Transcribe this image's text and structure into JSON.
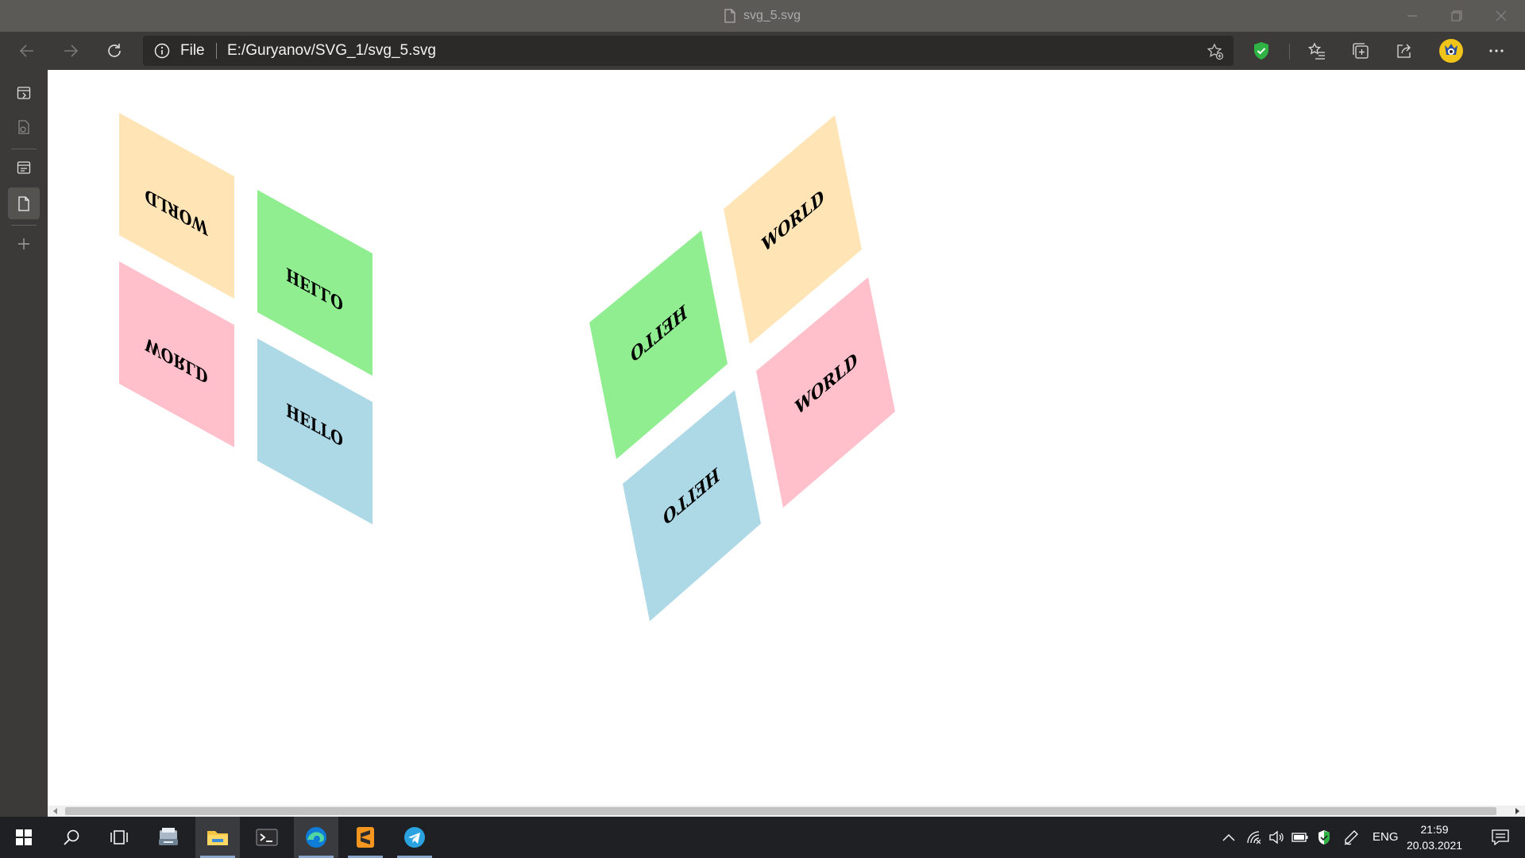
{
  "window": {
    "title": "svg_5.svg"
  },
  "address_bar": {
    "protocol_label": "File",
    "url": "E:/Guryanov/SVG_1/svg_5.svg"
  },
  "svg_content": {
    "labels": {
      "hello": "HELLO",
      "world": "WORLD"
    },
    "colors": {
      "green": "#90ee90",
      "blue": "#add8e6",
      "peach": "#ffe4b5",
      "pink": "#ffc0cb"
    }
  },
  "taskbar": {
    "apps": [
      "start-icon",
      "search-icon",
      "task-view-icon",
      "scanner-app-icon",
      "file-explorer-icon",
      "terminal-icon",
      "edge-icon",
      "sublime-text-icon",
      "telegram-icon"
    ],
    "language": "ENG",
    "time": "21:59",
    "date": "20.03.2021"
  }
}
